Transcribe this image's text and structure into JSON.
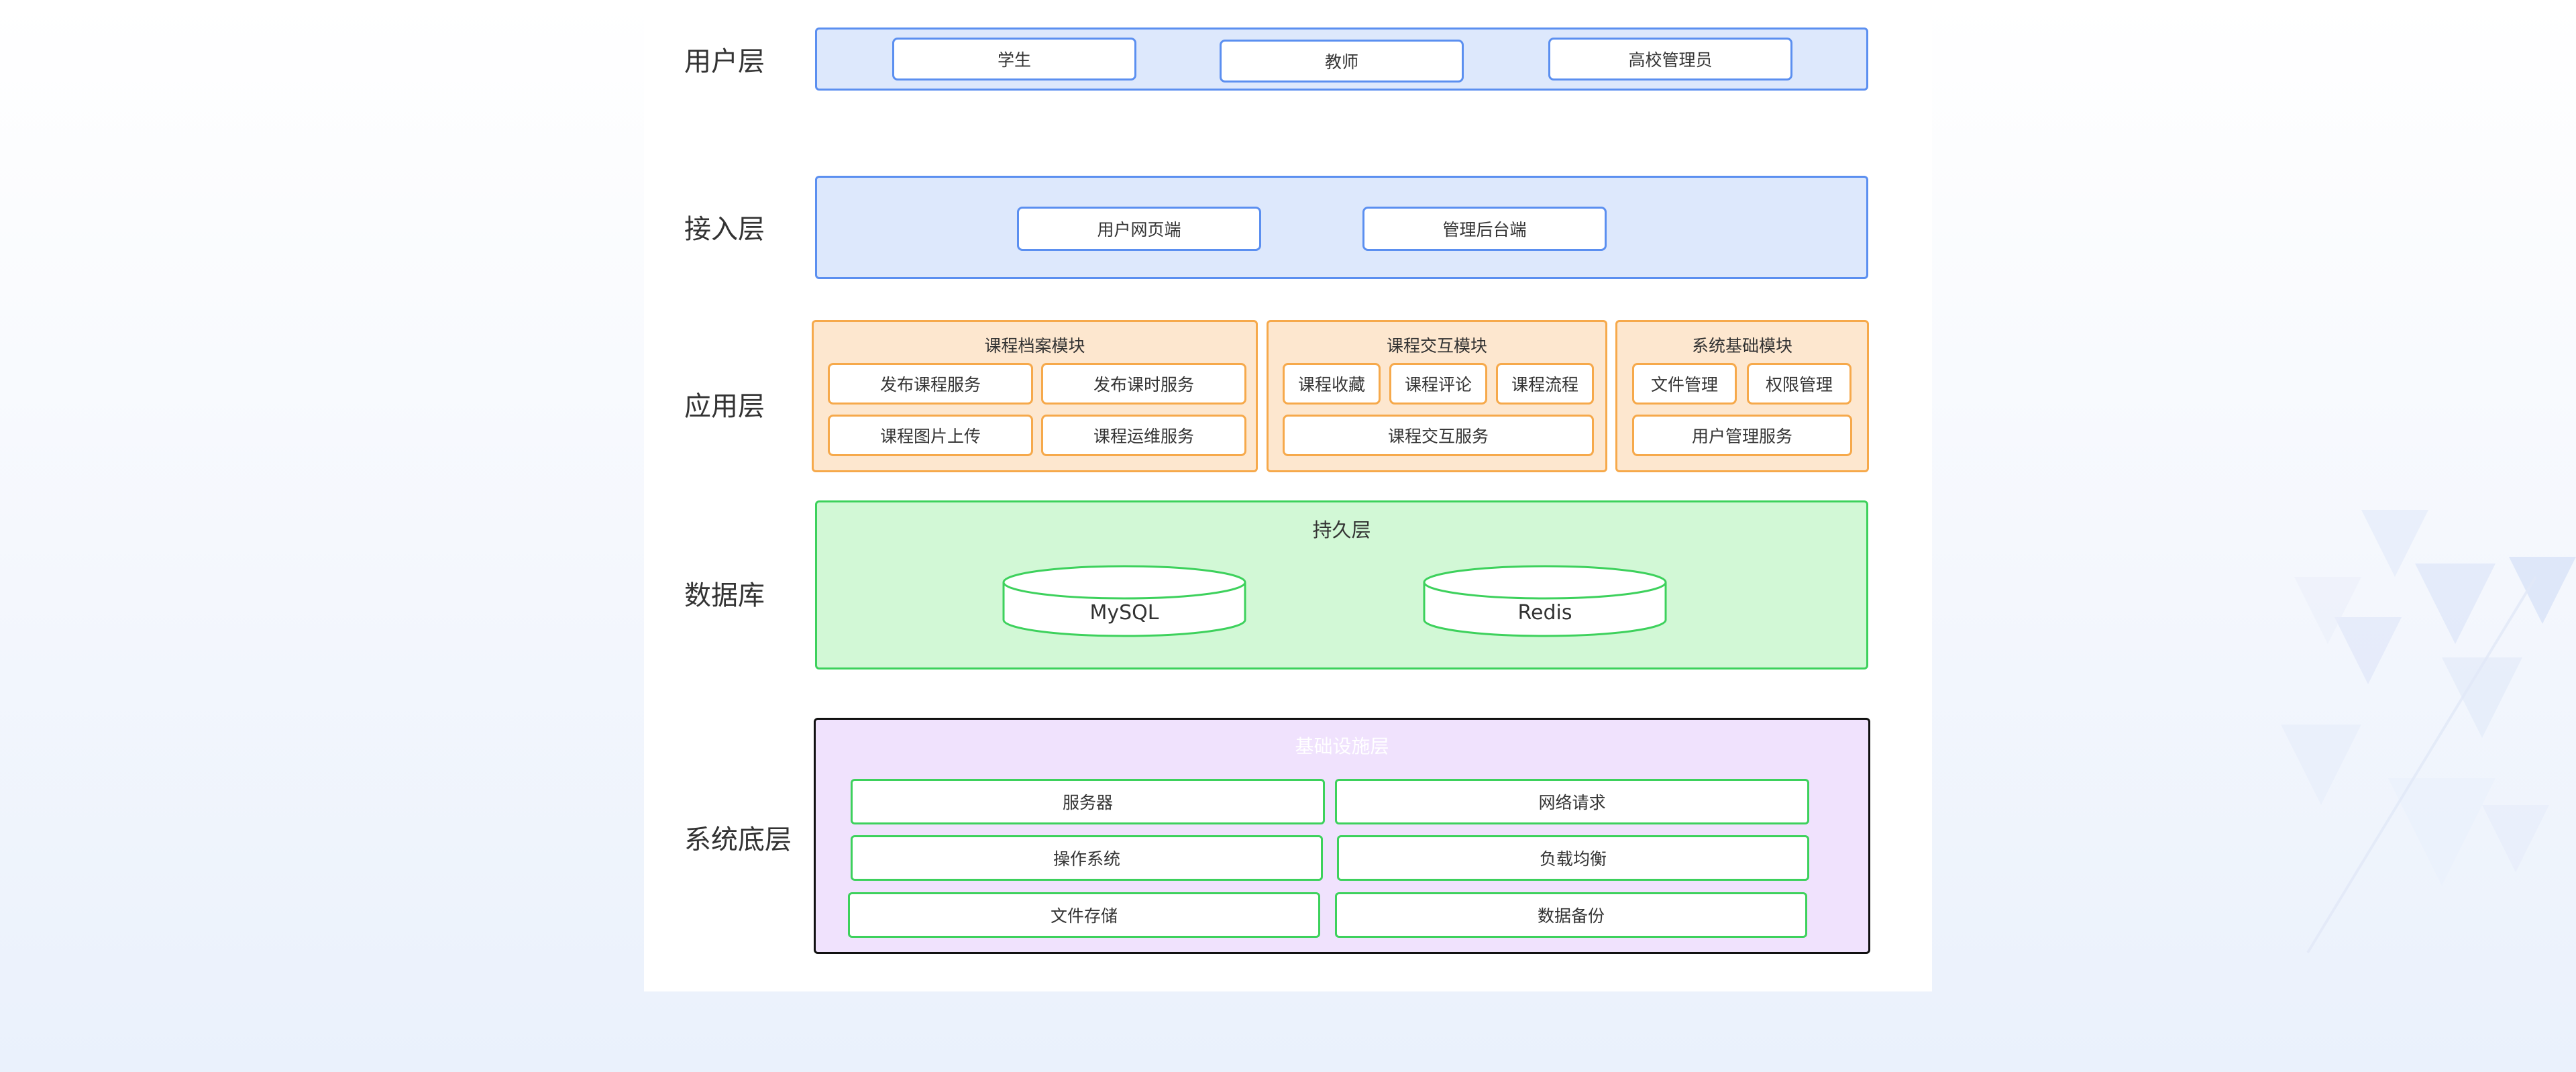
{
  "layers": {
    "user": "用户层",
    "access": "接入层",
    "app": "应用层",
    "db": "数据库",
    "system": "系统底层"
  },
  "user_layer": {
    "items": [
      "学生",
      "教师",
      "高校管理员"
    ]
  },
  "access_layer": {
    "items": [
      "用户网页端",
      "管理后台端"
    ]
  },
  "app_layer": {
    "archive": {
      "title": "课程档案模块",
      "items": [
        "发布课程服务",
        "发布课时服务",
        "课程图片上传",
        "课程运维服务"
      ]
    },
    "interaction": {
      "title": "课程交互模块",
      "items": [
        "课程收藏",
        "课程评论",
        "课程流程",
        "课程交互服务"
      ]
    },
    "basic": {
      "title": "系统基础模块",
      "items": [
        "文件管理",
        "权限管理",
        "用户管理服务"
      ]
    }
  },
  "persist_layer": {
    "title": "持久层",
    "items": [
      "MySQL",
      "Redis"
    ]
  },
  "infra_layer": {
    "title": "基础设施层",
    "items": [
      "服务器",
      "网络请求",
      "操作系统",
      "负载均衡",
      "文件存储",
      "数据备份"
    ]
  },
  "colors": {
    "blue_panel": "#dde8fc",
    "blue_border": "#5b8ff0",
    "orange_panel": "#fde7cf",
    "orange_border": "#f6a94b",
    "green_panel": "#d2f8d6",
    "green_border": "#3dd15c",
    "purple_panel": "#f0e2fd"
  }
}
